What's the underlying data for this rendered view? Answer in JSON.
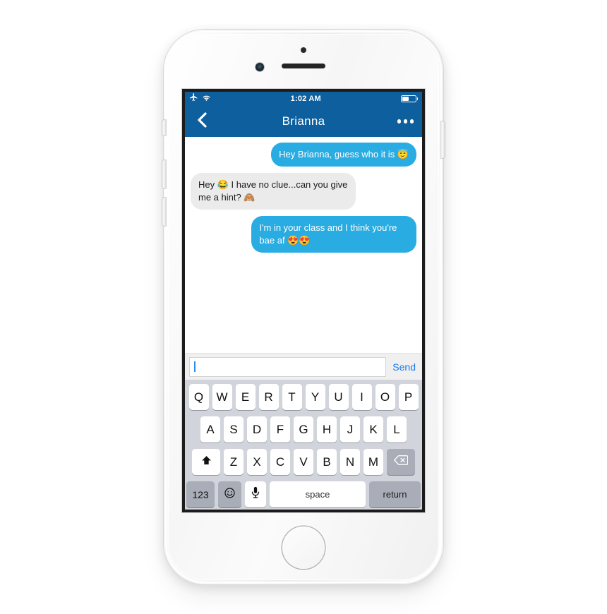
{
  "device": {
    "name": "iphone-white",
    "hardware": {
      "sensor": "proximity-sensor",
      "camera": "front-camera",
      "speaker": "earpiece-speaker",
      "home": "home-button",
      "buttons": [
        "silent-switch",
        "volume-up",
        "volume-down",
        "power-button"
      ]
    }
  },
  "status_bar": {
    "airplane_icon": "airplane-icon",
    "wifi_icon": "wifi-icon",
    "time": "1:02 AM",
    "battery_icon": "battery-icon",
    "battery_level_percent": 55,
    "background_color": "#0d5f9e"
  },
  "nav_bar": {
    "back_icon": "chevron-left-icon",
    "title": "Brianna",
    "more_icon": "more-horizontal-icon",
    "background_color": "#0d5f9e"
  },
  "conversation": {
    "bubble_out_color": "#29ace2",
    "bubble_in_color": "#ebebeb",
    "messages": [
      {
        "direction": "out",
        "text": "Hey Brianna, guess who it is ",
        "emoji": "😇",
        "emoji_name": "smiling-face-with-halo"
      },
      {
        "direction": "in",
        "text_before": "Hey ",
        "emoji_1": "😂",
        "emoji_1_name": "face-with-tears-of-joy",
        "text_middle": " I have no clue...can you give me a hint? ",
        "emoji_2": "🙈",
        "emoji_2_name": "see-no-evil-monkey"
      },
      {
        "direction": "out",
        "text": "I'm in your class and I think you're bae af ",
        "emoji": "😍😍",
        "emoji_name": "smiling-face-with-heart-eyes"
      }
    ]
  },
  "input_bar": {
    "value": "",
    "placeholder": "",
    "caret": "text-cursor",
    "send_label": "Send",
    "send_color": "#1878f0"
  },
  "keyboard": {
    "background_color": "#d1d4db",
    "row_1": [
      "Q",
      "W",
      "E",
      "R",
      "T",
      "Y",
      "U",
      "I",
      "O",
      "P"
    ],
    "row_2": [
      "A",
      "S",
      "D",
      "F",
      "G",
      "H",
      "J",
      "K",
      "L"
    ],
    "row_3_letters": [
      "Z",
      "X",
      "C",
      "V",
      "B",
      "N",
      "M"
    ],
    "shift_icon": "shift-arrow-icon",
    "shift_glyph": "⬆",
    "delete_icon": "backspace-icon",
    "delete_glyph": "⌫",
    "numbers_label": "123",
    "emoji_icon": "emoji-smiley-icon",
    "emoji_glyph": "☺",
    "mic_icon": "microphone-icon",
    "space_label": "space",
    "return_label": "return"
  }
}
